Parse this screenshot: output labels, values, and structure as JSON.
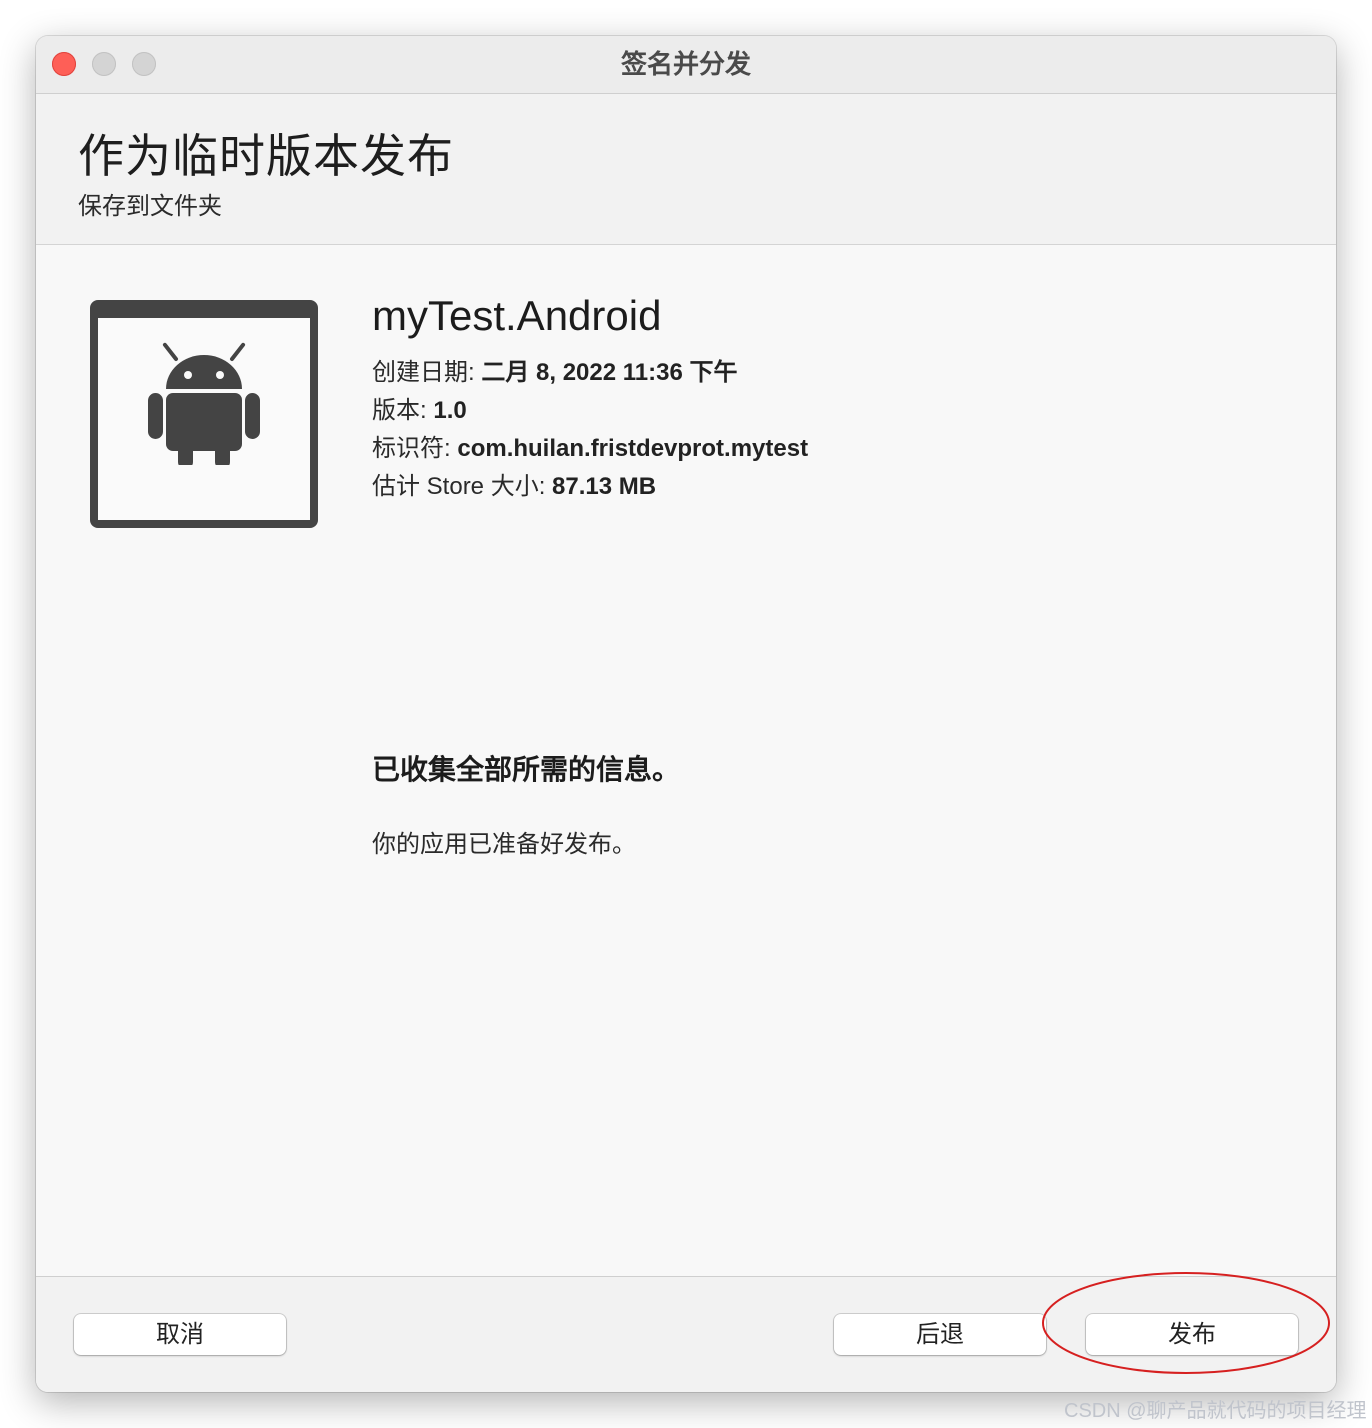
{
  "window": {
    "title": "签名并分发"
  },
  "header": {
    "title": "作为临时版本发布",
    "subtitle": "保存到文件夹"
  },
  "app": {
    "icon": "android-icon",
    "name": "myTest.Android",
    "created_label": "创建日期: ",
    "created_value": "二月 8, 2022 11:36 下午",
    "version_label": "版本: ",
    "version_value": "1.0",
    "identifier_label": "标识符: ",
    "identifier_value": "com.huilan.fristdevprot.mytest",
    "size_label": "估计 Store 大小: ",
    "size_value": "87.13 MB"
  },
  "status": {
    "title": "已收集全部所需的信息。",
    "message": "你的应用已准备好发布。"
  },
  "footer": {
    "cancel_label": "取消",
    "back_label": "后退",
    "publish_label": "发布"
  },
  "watermark": "CSDN @聊产品就代码的项目经理",
  "colors": {
    "close": "#fe5f57",
    "window_bg": "#f8f8f8",
    "icon_dark": "#444444",
    "annotation": "#d62020"
  }
}
